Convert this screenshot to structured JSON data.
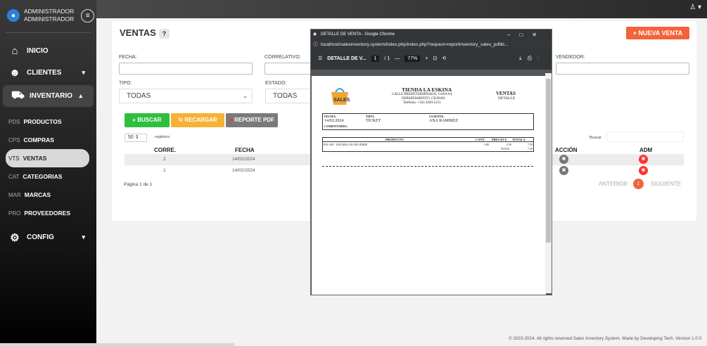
{
  "user": {
    "name": "ADMINISTRADOR",
    "role": "ADMINISTRADOR"
  },
  "sidebar": {
    "menu": [
      {
        "label": "INICIO"
      },
      {
        "label": "CLIENTES"
      },
      {
        "label": "INVENTARIO"
      }
    ],
    "sub": [
      {
        "code": "PDS",
        "label": "PRODUCTOS"
      },
      {
        "code": "CPS",
        "label": "COMPRAS"
      },
      {
        "code": "VTS",
        "label": "VENTAS"
      },
      {
        "code": "CAT",
        "label": "CATEGORIAS"
      },
      {
        "code": "MAR",
        "label": "MARCAS"
      },
      {
        "code": "PRO",
        "label": "PROVEEDORES"
      }
    ],
    "config": "CONFIG"
  },
  "page": {
    "title": "VENTAS",
    "help": "?",
    "new_button": "+ NUEVA VENTA"
  },
  "filters": {
    "fecha": "FECHA:",
    "correlativo": "CORRELATIVO:",
    "vendedor": "VENDEDOR:",
    "tipo": "TIPO:",
    "tipo_value": "TODAS",
    "estado": "ESTADO:",
    "estado_value": "TODAS"
  },
  "buttons": {
    "buscar": "BUSCAR",
    "recargar": "RECARGAR",
    "reporte": "REPORTE PDF"
  },
  "table": {
    "page_size": "50",
    "registros": "registros",
    "buscar": "Buscar",
    "headers": {
      "corre": "CORRE.",
      "fecha": "FECHA",
      "accion": "ACCIÓN",
      "adm": "ADM"
    },
    "rows": [
      {
        "corre": "2",
        "fecha": "14/02/2024"
      },
      {
        "corre": "1",
        "fecha": "14/02/2024"
      }
    ],
    "page_info": "Página 1 de 1",
    "prev": "ANTERIOR",
    "page": "1",
    "next": "SIGUIENTE"
  },
  "footer": "© 2023-2024. All rights reserved Sales Inventory System. Made by Developing Tech. Version 1.0.0",
  "popup": {
    "window_title": "DETALLE DE VENTA - Google Chrome",
    "url": "localhost/salesinventory.system/index.php/index.php?request=reportinventory_sales_pdf&t...",
    "doc_title": "DETALLE DE V...",
    "page": "1",
    "pages": "/ 1",
    "zoom": "77%",
    "pdf": {
      "store": "TIENDA LA ESKINA",
      "address1": "CALLE PREDETERMINADA, CASA #4,",
      "address2": "DEPARTAMENTO, CIUDAD.",
      "phone": "Teléfono: +503 2020-2121",
      "doc_h1": "VENTAS",
      "doc_h2": "DETALLE",
      "logo_text": "SALES",
      "fecha_l": "FECHA:",
      "fecha": "14/02/2024",
      "tipo_l": "TIPO:",
      "tipo": "TICKET",
      "cliente_l": "CLIENTE:",
      "cliente": "ANA RAMIREZ",
      "comentario_l": "COMENTARIO:",
      "col_producto": "PRODUCTO",
      "col_cant": "CANT",
      "col_precio": "PRECIO $",
      "col_total": "TOTAL $",
      "item": "ESC-001 - ESCOBA COLOR VERDE",
      "cant": "3.00",
      "precio": "2.50",
      "total": "7.50",
      "total_l": "TOTAL",
      "total_v": "7.50"
    }
  }
}
